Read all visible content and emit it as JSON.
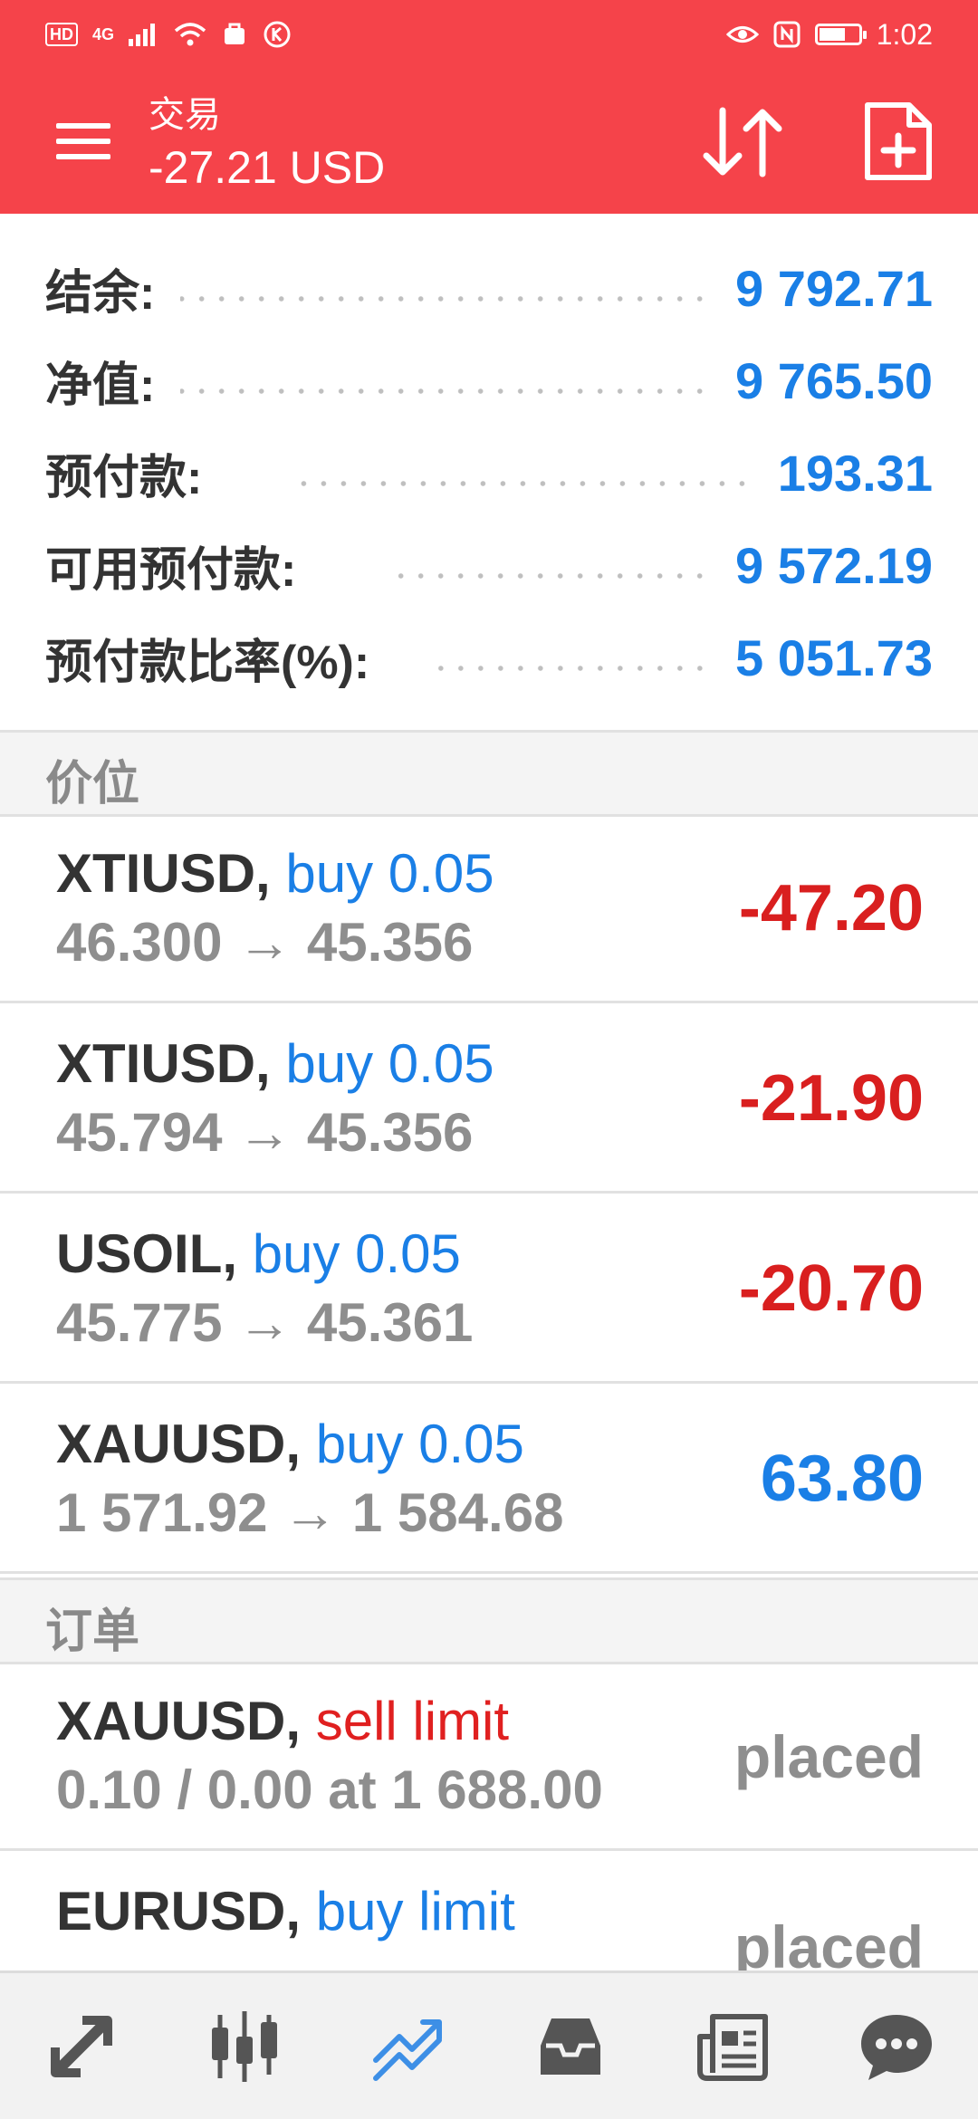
{
  "status_bar": {
    "left_badge": "HD",
    "signal": "4G",
    "time": "1:02",
    "battery_level": 0.7
  },
  "header": {
    "title": "交易",
    "subtitle": "-27.21 USD"
  },
  "summary": [
    {
      "label": "结余:",
      "value": "9 792.71"
    },
    {
      "label": "净值:",
      "value": "9 765.50"
    },
    {
      "label": "预付款:",
      "value": "193.31"
    },
    {
      "label": "可用预付款:",
      "value": "9 572.19"
    },
    {
      "label": "预付款比率(%):",
      "value": "5 051.73"
    }
  ],
  "positions_title": "价位",
  "positions": [
    {
      "symbol": "XTIUSD,",
      "side": "buy 0.05",
      "prices": "46.300 → 45.356",
      "profit": "-47.20"
    },
    {
      "symbol": "XTIUSD,",
      "side": "buy 0.05",
      "prices": "45.794 → 45.356",
      "profit": "-21.90"
    },
    {
      "symbol": "USOIL,",
      "side": "buy 0.05",
      "prices": "45.775 → 45.361",
      "profit": "-20.70"
    },
    {
      "symbol": "XAUUSD,",
      "side": "buy 0.05",
      "prices": "1 571.92 → 1 584.68",
      "profit": "63.80"
    }
  ],
  "orders_title": "订单",
  "orders": [
    {
      "symbol": "XAUUSD,",
      "side": "sell limit",
      "details": "0.10 / 0.00 at 1 688.00",
      "status": "placed"
    },
    {
      "symbol": "EURUSD,",
      "side": "buy limit",
      "details": "",
      "status": "placed"
    }
  ],
  "colors": {
    "header_bg": "#f5434a",
    "value_blue": "#1a7fe6",
    "loss_red": "#d91f1f"
  },
  "bottom_nav": [
    {
      "icon": "quotes-arrows-icon",
      "active": false
    },
    {
      "icon": "chart-candles-icon",
      "active": false
    },
    {
      "icon": "trade-trend-icon",
      "active": true
    },
    {
      "icon": "history-inbox-icon",
      "active": false
    },
    {
      "icon": "news-icon",
      "active": false
    },
    {
      "icon": "messages-chat-icon",
      "active": false
    }
  ]
}
